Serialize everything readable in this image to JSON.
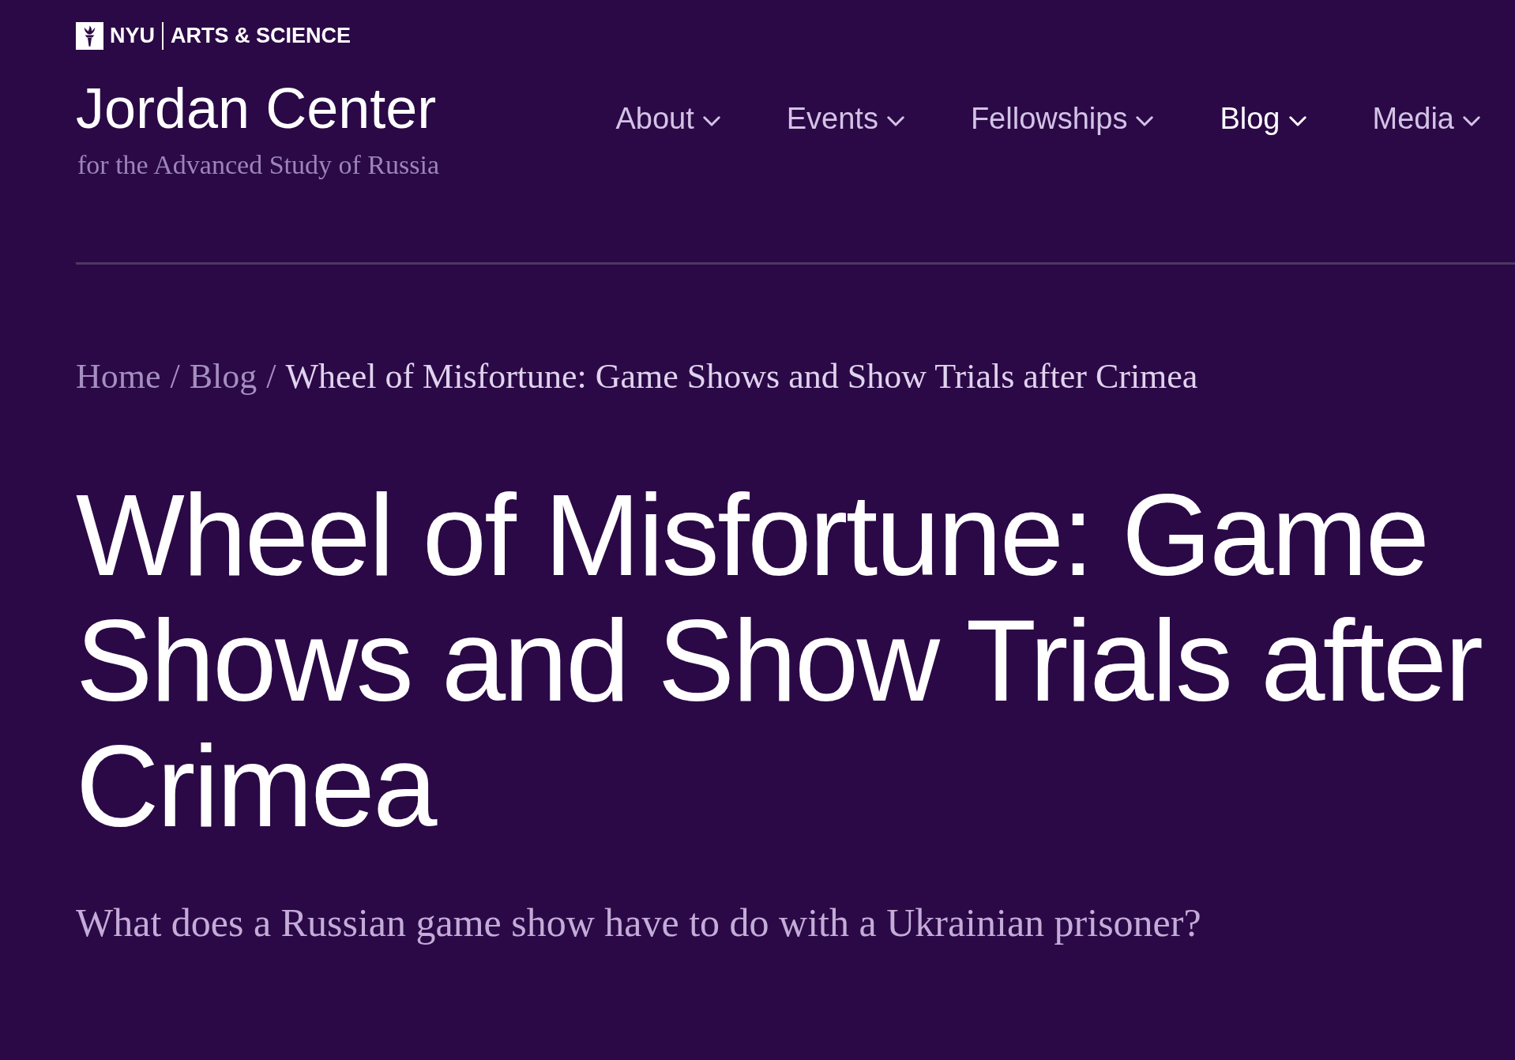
{
  "header": {
    "org_logo": {
      "primary": "NYU",
      "secondary": "ARTS & SCIENCE"
    },
    "site_title": "Jordan Center",
    "site_subtitle": "for the Advanced Study of Russia"
  },
  "nav": [
    {
      "label": "About",
      "selected": false
    },
    {
      "label": "Events",
      "selected": false
    },
    {
      "label": "Fellowships",
      "selected": false
    },
    {
      "label": "Blog",
      "selected": true
    },
    {
      "label": "Media",
      "selected": false
    }
  ],
  "breadcrumb": [
    {
      "label": "Home",
      "current": false,
      "separator": "/"
    },
    {
      "label": "Blog",
      "current": false,
      "separator": "/"
    },
    {
      "label": "Wheel of Misfortune: Game Shows and Show Trials after Crimea",
      "current": true
    }
  ],
  "article": {
    "title": "Wheel of Misfortune: Game Shows and Show Trials after Crimea",
    "dek": "What does a Russian game show have to do with a Ukrainian prisoner?"
  }
}
